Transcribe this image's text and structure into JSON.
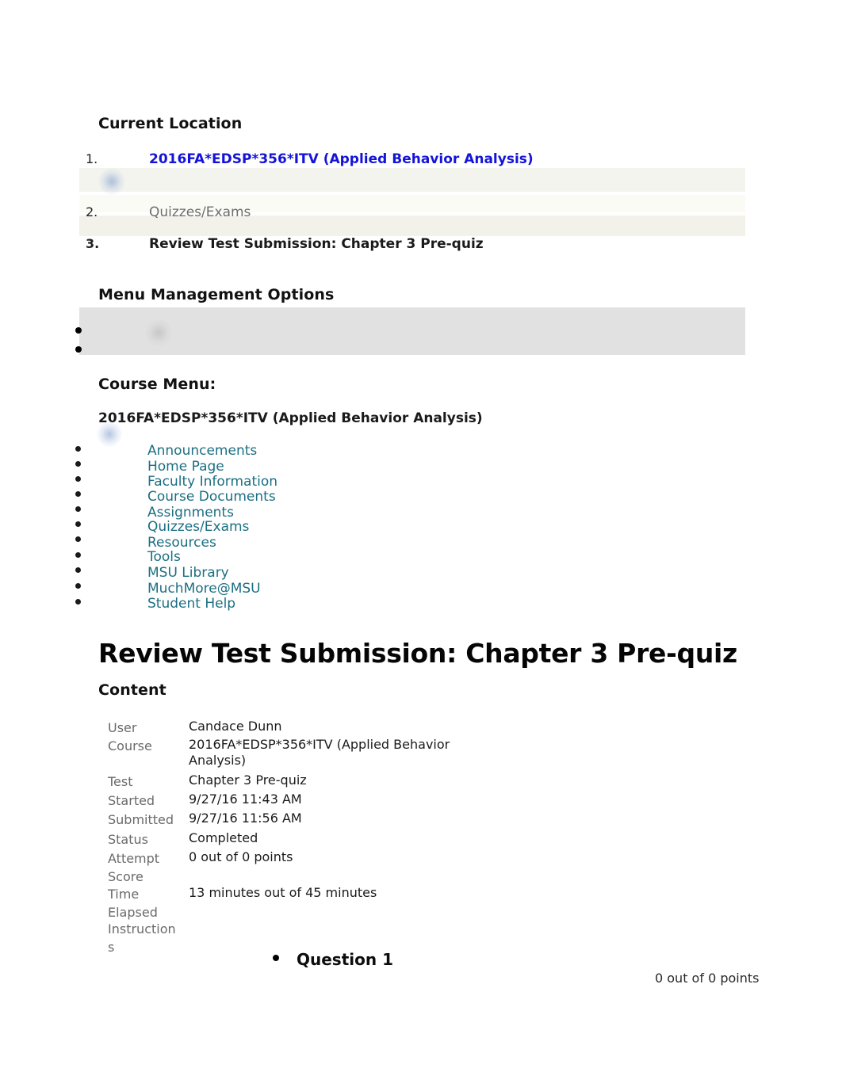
{
  "breadcrumb": {
    "heading": "Current Location",
    "items": [
      {
        "num": "1.",
        "label": "2016FA*EDSP*356*ITV (Applied Behavior Analysis)"
      },
      {
        "num": "2.",
        "label": "Quizzes/Exams"
      },
      {
        "num": "3.",
        "label": "Review Test Submission: Chapter 3 Pre-quiz"
      }
    ]
  },
  "menu_management": {
    "heading": "Menu Management Options",
    "items": [
      "",
      ""
    ]
  },
  "course_menu": {
    "heading": "Course Menu:",
    "course_title": "2016FA*EDSP*356*ITV (Applied Behavior Analysis)",
    "links": [
      "Announcements",
      "Home Page",
      "Faculty Information",
      "Course Documents",
      "Assignments",
      "Quizzes/Exams",
      "Resources",
      "Tools",
      "MSU Library",
      "MuchMore@MSU",
      "Student Help"
    ]
  },
  "page": {
    "title": "Review Test Submission: Chapter 3 Pre-quiz",
    "content_heading": "Content"
  },
  "info": {
    "rows": [
      {
        "label": "User",
        "value": "Candace Dunn"
      },
      {
        "label": "Course",
        "value": "2016FA*EDSP*356*ITV (Applied Behavior Analysis)"
      },
      {
        "label": "Test",
        "value": "Chapter 3 Pre-quiz"
      },
      {
        "label": "Started",
        "value": "9/27/16 11:43 AM"
      },
      {
        "label": "Submitted",
        "value": "9/27/16 11:56 AM"
      },
      {
        "label": "Status",
        "value": "Completed"
      },
      {
        "label": "Attempt Score",
        "value": "0 out of 0 points"
      },
      {
        "label": "Time Elapsed",
        "value": "13 minutes out of 45 minutes"
      },
      {
        "label": "Instructions",
        "value": ""
      }
    ]
  },
  "question": {
    "label": "Question 1",
    "points": "0 out of 0 points"
  },
  "colors": {
    "link_blue": "#1414d8",
    "menu_teal": "#1b6f82",
    "muted_gray": "#6d6d6d",
    "band_gray": "#e1e1e1",
    "band_beige": "#f4f4ee"
  }
}
